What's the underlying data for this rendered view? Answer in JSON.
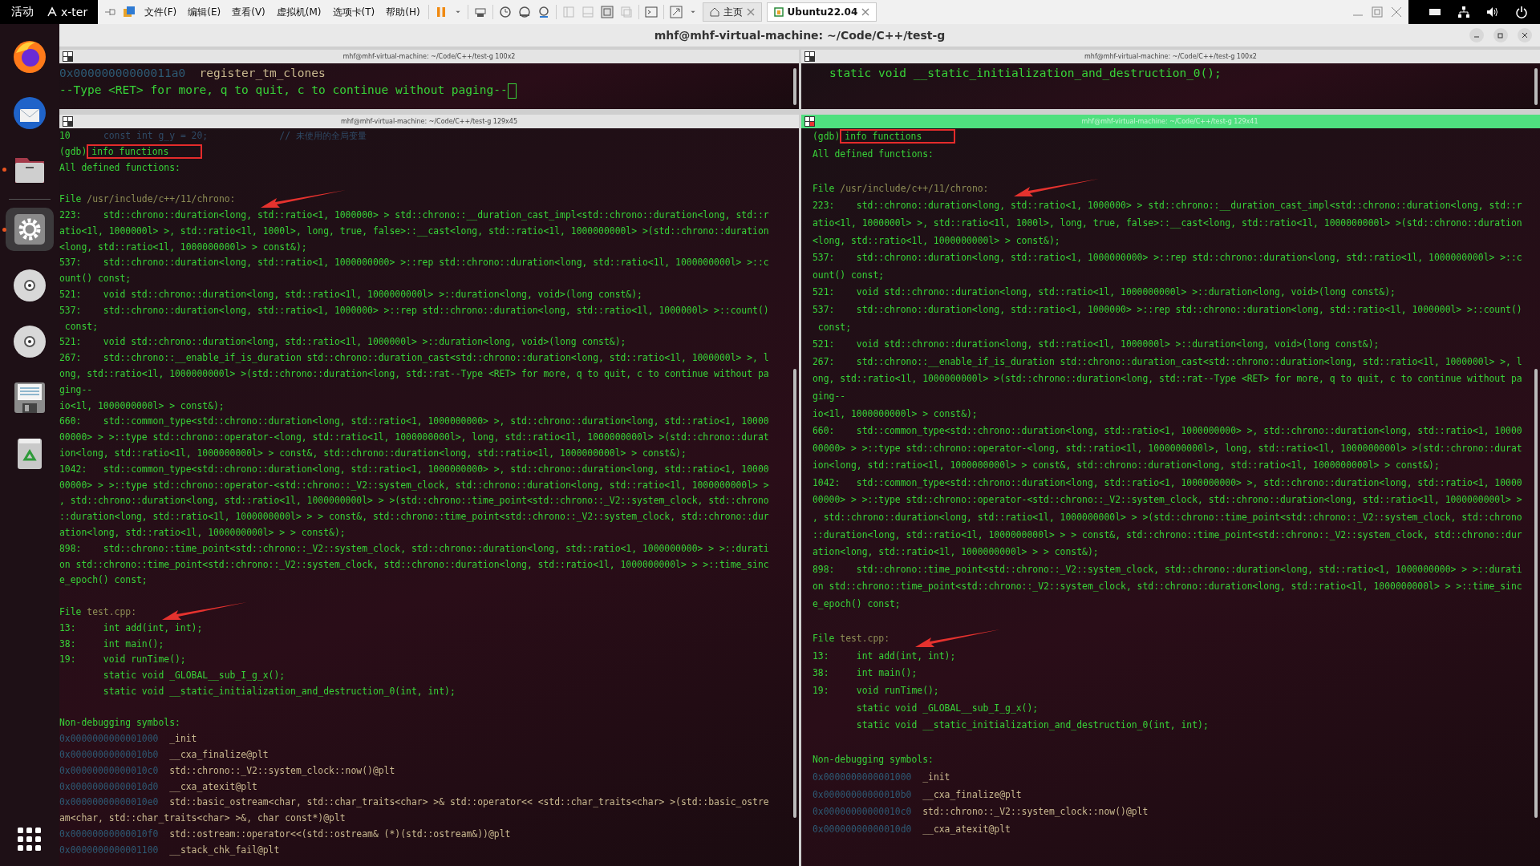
{
  "top_bar": {
    "activities": "活动",
    "app": "x-ter"
  },
  "vm_window": {
    "menu": [
      "文件(F)",
      "编辑(E)",
      "查看(V)",
      "虚拟机(M)",
      "选项卡(T)",
      "帮助(H)"
    ],
    "tabs": [
      {
        "label": "主页",
        "selected": false
      },
      {
        "label": "Ubuntu22.04",
        "selected": true
      }
    ]
  },
  "dock": [
    {
      "kind": "browser",
      "running": false,
      "selected": false
    },
    {
      "kind": "mail",
      "running": false,
      "selected": false
    },
    {
      "kind": "files",
      "running": true,
      "selected": false
    },
    {
      "kind": "settings",
      "running": true,
      "selected": true
    },
    {
      "kind": "disc",
      "running": false,
      "selected": false
    },
    {
      "kind": "disc",
      "running": false,
      "selected": false
    },
    {
      "kind": "floppy",
      "running": false,
      "selected": false
    },
    {
      "kind": "trash",
      "running": false,
      "selected": false
    }
  ],
  "window": {
    "title": "mhf@mhf-virtual-machine: ~/Code/C++/test-g"
  },
  "columns": [
    {
      "panes": [
        {
          "title": "mhf@mhf-virtual-machine: ~/Code/C++/test-g 100x2",
          "kind": "small",
          "active": false,
          "lines": [
            {
              "kind": "symbol",
              "address": "0x00000000000011a0",
              "name": "register_tm_clones"
            },
            {
              "kind": "more",
              "text": "--Type <RET> for more, q to quit, c to continue without paging--"
            }
          ]
        },
        {
          "title": "mhf@mhf-virtual-machine: ~/Code/C++/test-g 129x45",
          "kind": "large",
          "active": false,
          "lines": [
            {
              "kind": "source",
              "number": "10",
              "code": "const int g_y = 20;",
              "comment": "// 未使用的全局变量"
            },
            {
              "kind": "prompt",
              "prompt": "(gdb)",
              "command": "info functions"
            },
            {
              "kind": "text",
              "text": "All defined functions:"
            },
            {
              "kind": "blank"
            },
            {
              "kind": "file",
              "label": "File",
              "path": "/usr/include/c++/11/chrono:",
              "arrow": true
            },
            {
              "kind": "text",
              "text": "223:    std::chrono::duration<long, std::ratio<1, 1000000> > std::chrono::__duration_cast_impl<std::chrono::duration<long, std::r"
            },
            {
              "kind": "text",
              "text": "atio<1l, 1000000l> >, std::ratio<1l, 1000l>, long, true, false>::__cast<long, std::ratio<1l, 1000000000l> >(std::chrono::duration"
            },
            {
              "kind": "text",
              "text": "<long, std::ratio<1l, 1000000000l> > const&);"
            },
            {
              "kind": "text",
              "text": "537:    std::chrono::duration<long, std::ratio<1, 1000000000> >::rep std::chrono::duration<long, std::ratio<1l, 1000000000l> >::c"
            },
            {
              "kind": "text",
              "text": "ount() const;"
            },
            {
              "kind": "text",
              "text": "521:    void std::chrono::duration<long, std::ratio<1l, 1000000000l> >::duration<long, void>(long const&);"
            },
            {
              "kind": "text",
              "text": "537:    std::chrono::duration<long, std::ratio<1, 1000000> >::rep std::chrono::duration<long, std::ratio<1l, 1000000l> >::count()"
            },
            {
              "kind": "text",
              "text": " const;"
            },
            {
              "kind": "text",
              "text": "521:    void std::chrono::duration<long, std::ratio<1l, 1000000l> >::duration<long, void>(long const&);"
            },
            {
              "kind": "text",
              "text": "267:    std::chrono::__enable_if_is_duration std::chrono::duration_cast<std::chrono::duration<long, std::ratio<1l, 1000000l> >, l"
            },
            {
              "kind": "text",
              "text": "ong, std::ratio<1l, 1000000000l> >(std::chrono::duration<long, std::rat--Type <RET> for more, q to quit, c to continue without pa"
            },
            {
              "kind": "text",
              "text": "ging--"
            },
            {
              "kind": "text",
              "text": "io<1l, 1000000000l> > const&);"
            },
            {
              "kind": "text",
              "text": "660:    std::common_type<std::chrono::duration<long, std::ratio<1, 1000000000> >, std::chrono::duration<long, std::ratio<1, 10000"
            },
            {
              "kind": "text",
              "text": "00000> > >::type std::chrono::operator-<long, std::ratio<1l, 1000000000l>, long, std::ratio<1l, 1000000000l> >(std::chrono::durat"
            },
            {
              "kind": "text",
              "text": "ion<long, std::ratio<1l, 1000000000l> > const&, std::chrono::duration<long, std::ratio<1l, 1000000000l> > const&);"
            },
            {
              "kind": "text",
              "text": "1042:   std::common_type<std::chrono::duration<long, std::ratio<1, 1000000000> >, std::chrono::duration<long, std::ratio<1, 10000"
            },
            {
              "kind": "text",
              "text": "00000> > >::type std::chrono::operator-<std::chrono::_V2::system_clock, std::chrono::duration<long, std::ratio<1l, 1000000000l> >"
            },
            {
              "kind": "text",
              "text": ", std::chrono::duration<long, std::ratio<1l, 1000000000l> > >(std::chrono::time_point<std::chrono::_V2::system_clock, std::chrono"
            },
            {
              "kind": "text",
              "text": "::duration<long, std::ratio<1l, 1000000000l> > > const&, std::chrono::time_point<std::chrono::_V2::system_clock, std::chrono::dur"
            },
            {
              "kind": "text",
              "text": "ation<long, std::ratio<1l, 1000000000l> > > const&);"
            },
            {
              "kind": "text",
              "text": "898:    std::chrono::time_point<std::chrono::_V2::system_clock, std::chrono::duration<long, std::ratio<1, 1000000000> > >::durati"
            },
            {
              "kind": "text",
              "text": "on std::chrono::time_point<std::chrono::_V2::system_clock, std::chrono::duration<long, std::ratio<1l, 1000000000l> > >::time_sinc"
            },
            {
              "kind": "text",
              "text": "e_epoch() const;"
            },
            {
              "kind": "blank"
            },
            {
              "kind": "file",
              "label": "File",
              "path": "test.cpp:",
              "arrow": true
            },
            {
              "kind": "text",
              "text": "13:     int add(int, int);"
            },
            {
              "kind": "text",
              "text": "38:     int main();"
            },
            {
              "kind": "text",
              "text": "19:     void runTime();"
            },
            {
              "kind": "text",
              "text": "        static void _GLOBAL__sub_I_g_x();"
            },
            {
              "kind": "text",
              "text": "        static void __static_initialization_and_destruction_0(int, int);"
            },
            {
              "kind": "blank"
            },
            {
              "kind": "text",
              "text": "Non-debugging symbols:"
            },
            {
              "kind": "symbol",
              "address": "0x0000000000001000",
              "name": "_init"
            },
            {
              "kind": "symbol",
              "address": "0x00000000000010b0",
              "name": "__cxa_finalize@plt"
            },
            {
              "kind": "symbol",
              "address": "0x00000000000010c0",
              "name": "std::chrono::_V2::system_clock::now()@plt"
            },
            {
              "kind": "symbol",
              "address": "0x00000000000010d0",
              "name": "__cxa_atexit@plt"
            },
            {
              "kind": "symbol",
              "address": "0x00000000000010e0",
              "name": "std::basic_ostream<char, std::char_traits<char> >& std::operator<< <std::char_traits<char> >(std::basic_ostre"
            },
            {
              "kind": "symbol_cont",
              "text": "am<char, std::char_traits<char> >&, char const*)@plt"
            },
            {
              "kind": "symbol",
              "address": "0x00000000000010f0",
              "name": "std::ostream::operator<<(std::ostream& (*)(std::ostream&))@plt"
            },
            {
              "kind": "symbol",
              "address": "0x0000000000001100",
              "name": "__stack_chk_fail@plt"
            }
          ]
        }
      ]
    },
    {
      "panes": [
        {
          "title": "mhf@mhf-virtual-machine: ~/Code/C++/test-g 100x2",
          "kind": "small",
          "active": false,
          "lines": [
            {
              "kind": "text",
              "text": "    static void __static_initialization_and_destruction_0();"
            }
          ]
        },
        {
          "title": "mhf@mhf-virtual-machine: ~/Code/C++/test-g 129x41",
          "kind": "large",
          "active": true,
          "lines": [
            {
              "kind": "prompt",
              "prompt": "(gdb)",
              "command": "info functions"
            },
            {
              "kind": "text",
              "text": "All defined functions:"
            },
            {
              "kind": "blank"
            },
            {
              "kind": "file",
              "label": "File",
              "path": "/usr/include/c++/11/chrono:",
              "arrow": true
            },
            {
              "kind": "text",
              "text": "223:    std::chrono::duration<long, std::ratio<1, 1000000> > std::chrono::__duration_cast_impl<std::chrono::duration<long, std::r"
            },
            {
              "kind": "text",
              "text": "atio<1l, 1000000l> >, std::ratio<1l, 1000l>, long, true, false>::__cast<long, std::ratio<1l, 1000000000l> >(std::chrono::duration"
            },
            {
              "kind": "text",
              "text": "<long, std::ratio<1l, 1000000000l> > const&);"
            },
            {
              "kind": "text",
              "text": "537:    std::chrono::duration<long, std::ratio<1, 1000000000> >::rep std::chrono::duration<long, std::ratio<1l, 1000000000l> >::c"
            },
            {
              "kind": "text",
              "text": "ount() const;"
            },
            {
              "kind": "text",
              "text": "521:    void std::chrono::duration<long, std::ratio<1l, 1000000000l> >::duration<long, void>(long const&);"
            },
            {
              "kind": "text",
              "text": "537:    std::chrono::duration<long, std::ratio<1, 1000000> >::rep std::chrono::duration<long, std::ratio<1l, 1000000l> >::count()"
            },
            {
              "kind": "text",
              "text": " const;"
            },
            {
              "kind": "text",
              "text": "521:    void std::chrono::duration<long, std::ratio<1l, 1000000l> >::duration<long, void>(long const&);"
            },
            {
              "kind": "text",
              "text": "267:    std::chrono::__enable_if_is_duration std::chrono::duration_cast<std::chrono::duration<long, std::ratio<1l, 1000000l> >, l"
            },
            {
              "kind": "text",
              "text": "ong, std::ratio<1l, 1000000000l> >(std::chrono::duration<long, std::rat--Type <RET> for more, q to quit, c to continue without pa"
            },
            {
              "kind": "text",
              "text": "ging--"
            },
            {
              "kind": "text",
              "text": "io<1l, 1000000000l> > const&);"
            },
            {
              "kind": "text",
              "text": "660:    std::common_type<std::chrono::duration<long, std::ratio<1, 1000000000> >, std::chrono::duration<long, std::ratio<1, 10000"
            },
            {
              "kind": "text",
              "text": "00000> > >::type std::chrono::operator-<long, std::ratio<1l, 1000000000l>, long, std::ratio<1l, 1000000000l> >(std::chrono::durat"
            },
            {
              "kind": "text",
              "text": "ion<long, std::ratio<1l, 1000000000l> > const&, std::chrono::duration<long, std::ratio<1l, 1000000000l> > const&);"
            },
            {
              "kind": "text",
              "text": "1042:   std::common_type<std::chrono::duration<long, std::ratio<1, 1000000000> >, std::chrono::duration<long, std::ratio<1, 10000"
            },
            {
              "kind": "text",
              "text": "00000> > >::type std::chrono::operator-<std::chrono::_V2::system_clock, std::chrono::duration<long, std::ratio<1l, 1000000000l> >"
            },
            {
              "kind": "text",
              "text": ", std::chrono::duration<long, std::ratio<1l, 1000000000l> > >(std::chrono::time_point<std::chrono::_V2::system_clock, std::chrono"
            },
            {
              "kind": "text",
              "text": "::duration<long, std::ratio<1l, 1000000000l> > > const&, std::chrono::time_point<std::chrono::_V2::system_clock, std::chrono::dur"
            },
            {
              "kind": "text",
              "text": "ation<long, std::ratio<1l, 1000000000l> > > const&);"
            },
            {
              "kind": "text",
              "text": "898:    std::chrono::time_point<std::chrono::_V2::system_clock, std::chrono::duration<long, std::ratio<1, 1000000000> > >::durati"
            },
            {
              "kind": "text",
              "text": "on std::chrono::time_point<std::chrono::_V2::system_clock, std::chrono::duration<long, std::ratio<1l, 1000000000l> > >::time_sinc"
            },
            {
              "kind": "text",
              "text": "e_epoch() const;"
            },
            {
              "kind": "blank"
            },
            {
              "kind": "file",
              "label": "File",
              "path": "test.cpp:",
              "arrow": true
            },
            {
              "kind": "text",
              "text": "13:     int add(int, int);"
            },
            {
              "kind": "text",
              "text": "38:     int main();"
            },
            {
              "kind": "text",
              "text": "19:     void runTime();"
            },
            {
              "kind": "text",
              "text": "        static void _GLOBAL__sub_I_g_x();"
            },
            {
              "kind": "text",
              "text": "        static void __static_initialization_and_destruction_0(int, int);"
            },
            {
              "kind": "blank"
            },
            {
              "kind": "text",
              "text": "Non-debugging symbols:"
            },
            {
              "kind": "symbol",
              "address": "0x0000000000001000",
              "name": "_init"
            },
            {
              "kind": "symbol",
              "address": "0x00000000000010b0",
              "name": "__cxa_finalize@plt"
            },
            {
              "kind": "symbol",
              "address": "0x00000000000010c0",
              "name": "std::chrono::_V2::system_clock::now()@plt"
            },
            {
              "kind": "symbol",
              "address": "0x00000000000010d0",
              "name": "__cxa_atexit@plt"
            }
          ]
        }
      ]
    }
  ]
}
